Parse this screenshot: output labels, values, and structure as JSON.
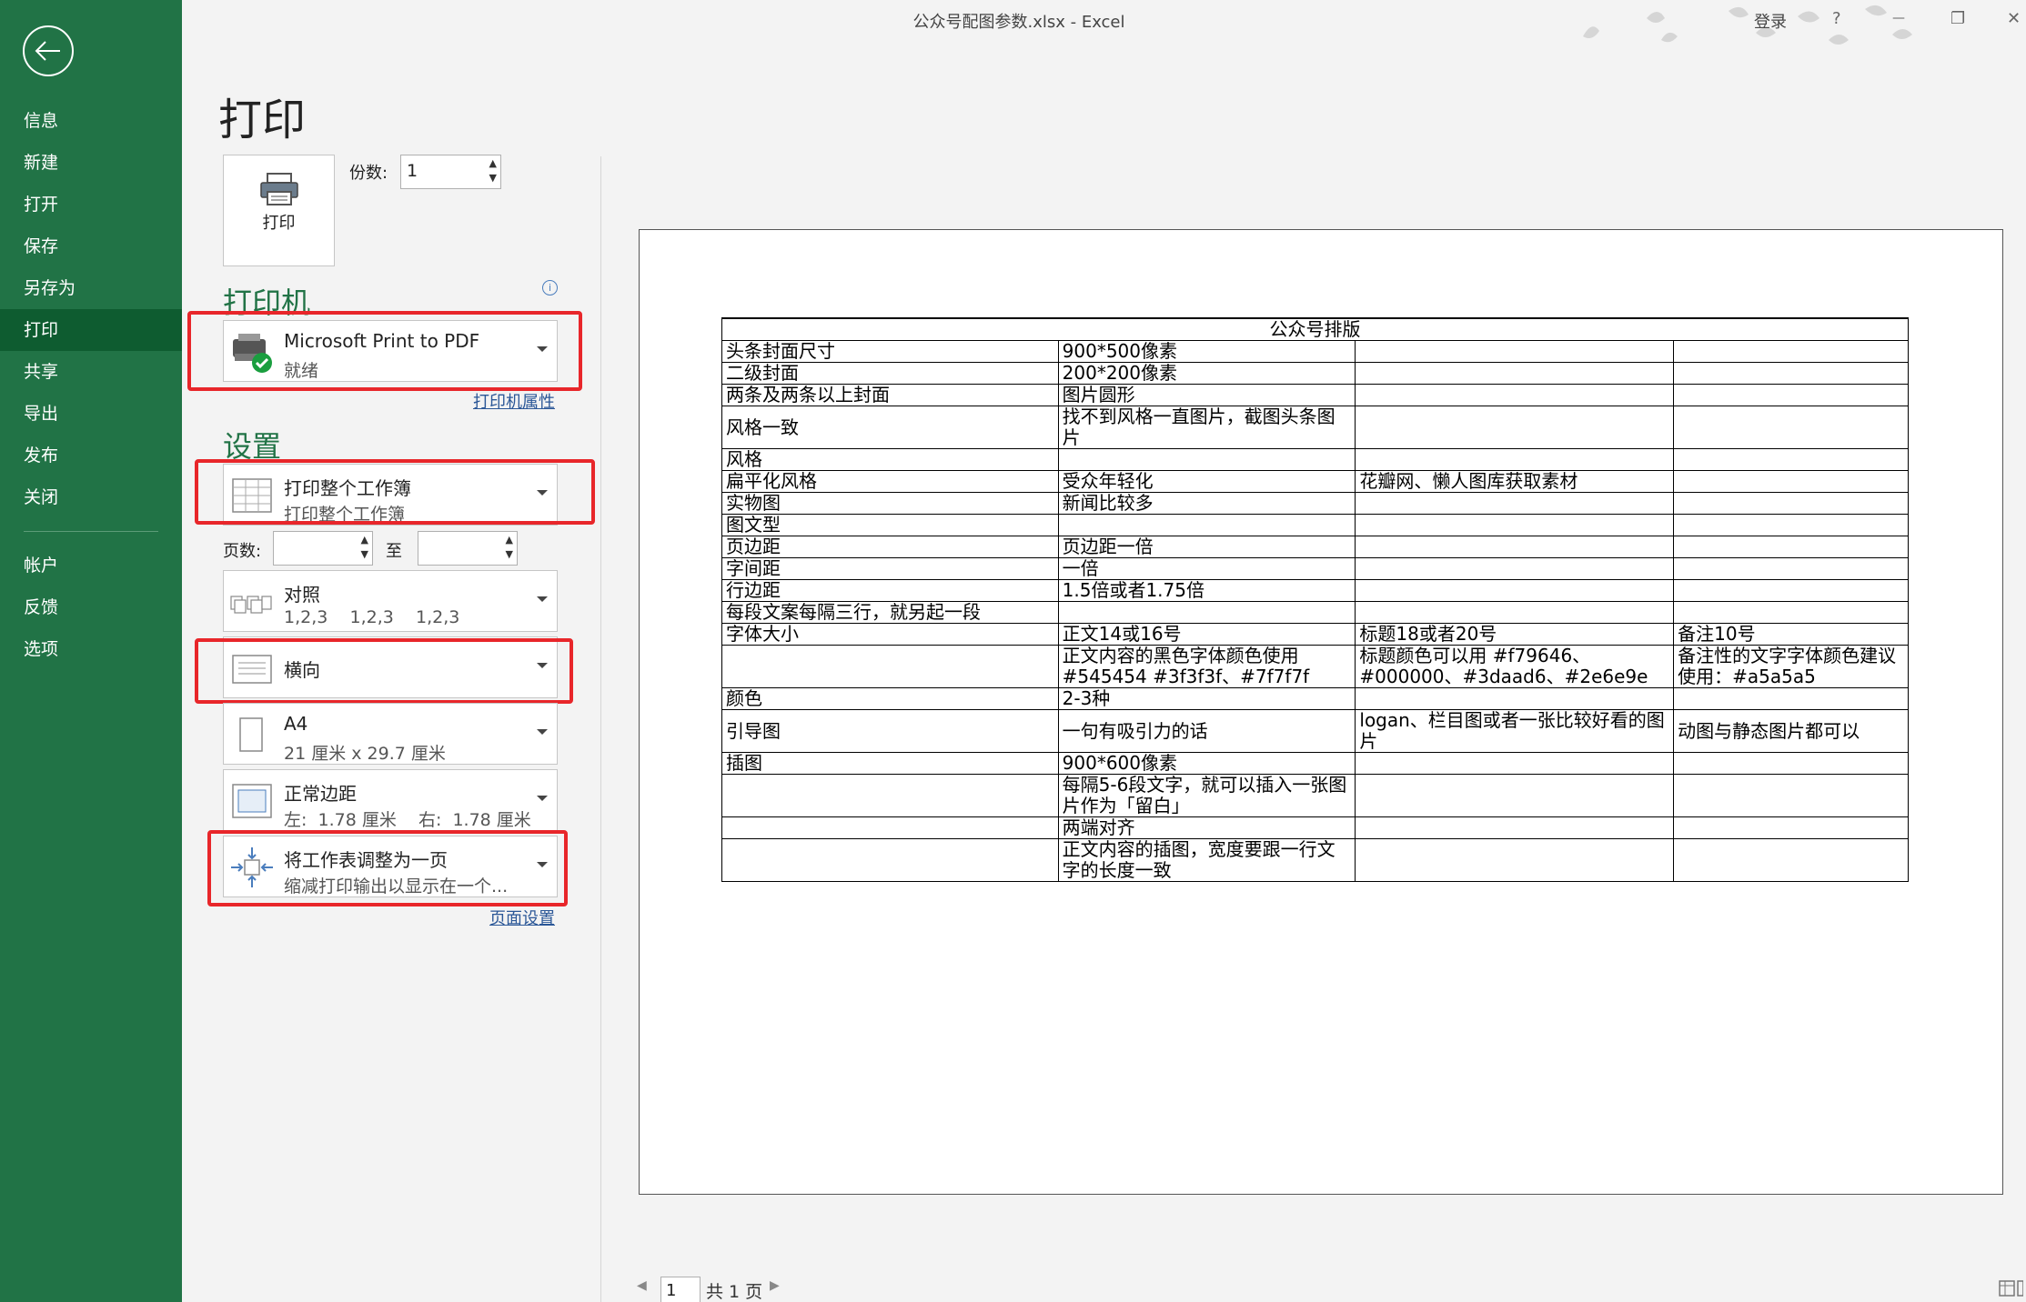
{
  "window": {
    "title": "公众号配图参数.xlsx  -  Excel",
    "login": "登录",
    "help": "?",
    "minimize": "—",
    "restore": "❐",
    "close": "✕"
  },
  "nav": {
    "items": [
      "信息",
      "新建",
      "打开",
      "保存",
      "另存为",
      "打印",
      "共享",
      "导出",
      "发布",
      "关闭"
    ],
    "bottom_items": [
      "帐户",
      "反馈",
      "选项"
    ],
    "active": "打印"
  },
  "print": {
    "title": "打印",
    "button_label": "打印",
    "copies_label": "份数:",
    "copies_value": "1"
  },
  "printer": {
    "heading": "打印机",
    "name": "Microsoft Print to PDF",
    "status": "就绪",
    "properties_link": "打印机属性"
  },
  "settings": {
    "heading": "设置",
    "scope": {
      "title": "打印整个工作簿",
      "sub": "打印整个工作簿"
    },
    "pages_label": "页数:",
    "pages_to": "至",
    "collate": {
      "title": "对照",
      "sub": "1,2,3    1,2,3    1,2,3"
    },
    "orientation": {
      "title": "横向"
    },
    "paper": {
      "title": "A4",
      "sub": "21 厘米 x 29.7 厘米"
    },
    "margins": {
      "title": "正常边距",
      "sub": "左:  1.78 厘米    右:  1.78 厘米"
    },
    "scaling": {
      "title": "将工作表调整为一页",
      "sub": "缩减打印输出以显示在一个..."
    },
    "page_setup_link": "页面设置"
  },
  "preview": {
    "table_title": "公众号排版",
    "rows": [
      [
        "头条封面尺寸",
        "900*500像素",
        "",
        ""
      ],
      [
        "二级封面",
        "200*200像素",
        "",
        ""
      ],
      [
        "两条及两条以上封面",
        "图片圆形",
        "",
        ""
      ],
      [
        "风格一致",
        "找不到风格一直图片，截图头条图片",
        "",
        ""
      ],
      [
        "风格",
        "",
        "",
        ""
      ],
      [
        "扁平化风格",
        "受众年轻化",
        "花瓣网、懒人图库获取素材",
        ""
      ],
      [
        "实物图",
        "新闻比较多",
        "",
        ""
      ],
      [
        "图文型",
        "",
        "",
        ""
      ],
      [
        "页边距",
        "页边距一倍",
        "",
        ""
      ],
      [
        "字间距",
        "一倍",
        "",
        ""
      ],
      [
        "行边距",
        "1.5倍或者1.75倍",
        "",
        ""
      ],
      [
        "每段文案每隔三行，就另起一段",
        "",
        "",
        ""
      ],
      [
        "字体大小",
        "正文14或16号",
        "标题18或者20号",
        "备注10号"
      ],
      [
        "",
        "正文内容的黑色字体颜色使用#545454 #3f3f3f、#7f7f7f",
        "标题颜色可以用 #f79646、#000000、#3daad6、#2e6e9e",
        "备注性的文字字体颜色建议使用：#a5a5a5"
      ],
      [
        "颜色",
        "2-3种",
        "",
        ""
      ],
      [
        "引导图",
        "一句有吸引力的话",
        "logan、栏目图或者一张比较好看的图片",
        "动图与静态图片都可以"
      ],
      [
        "插图",
        "900*600像素",
        "",
        ""
      ],
      [
        "",
        "每隔5-6段文字，就可以插入一张图片作为「留白」",
        "",
        ""
      ],
      [
        "",
        "两端对齐",
        "",
        ""
      ],
      [
        "",
        "正文内容的插图，宽度要跟一行文字的长度一致",
        "",
        ""
      ]
    ],
    "page_current": "1",
    "page_total": "共 1 页"
  },
  "colors": {
    "nav_bg": "#217346",
    "nav_active": "#0e5c30",
    "accent": "#217346",
    "highlight": "#e8262a"
  }
}
